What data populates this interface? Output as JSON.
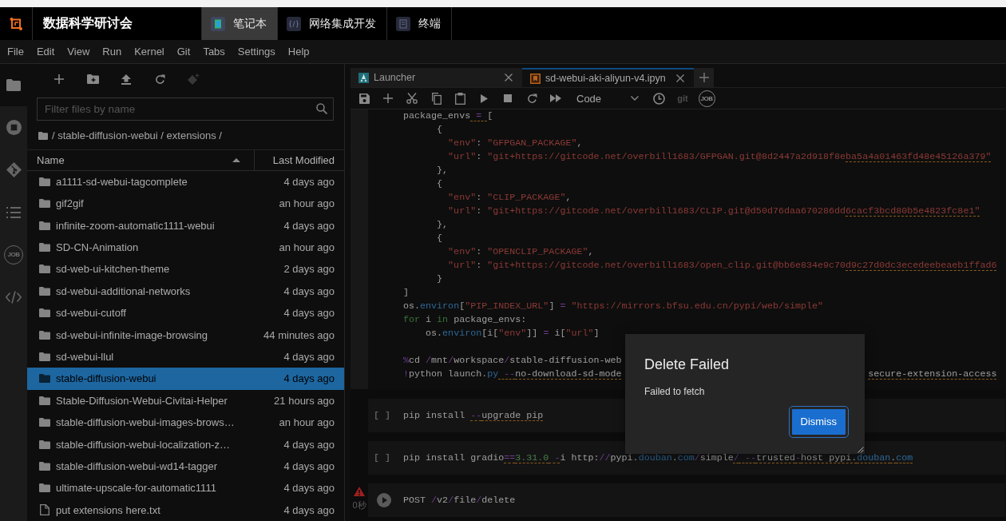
{
  "top_bar": {
    "title": "数据科学研讨会",
    "tabs": [
      {
        "kind": "notebook",
        "label": "笔记本",
        "selected": true
      },
      {
        "kind": "ide",
        "label": "网络集成开发",
        "selected": false
      },
      {
        "kind": "terminal",
        "label": "终端",
        "selected": false
      }
    ]
  },
  "menu": [
    "File",
    "Edit",
    "View",
    "Run",
    "Kernel",
    "Git",
    "Tabs",
    "Settings",
    "Help"
  ],
  "sidebar": {
    "items": [
      {
        "kind": "files",
        "selected": true
      },
      {
        "kind": "running",
        "selected": false
      },
      {
        "kind": "git",
        "selected": false
      },
      {
        "kind": "toc",
        "selected": false
      },
      {
        "kind": "jobs",
        "label": "JOB",
        "selected": false
      },
      {
        "kind": "snippets",
        "selected": false
      }
    ]
  },
  "file_browser": {
    "toolbar": [
      {
        "kind": "new-launcher",
        "disabled": false
      },
      {
        "kind": "new-folder",
        "disabled": false
      },
      {
        "kind": "upload",
        "disabled": false
      },
      {
        "kind": "refresh",
        "disabled": false
      },
      {
        "kind": "git-clone",
        "disabled": true
      }
    ],
    "filter": {
      "placeholder": "Filter files by name"
    },
    "breadcrumb": "/ stable-diffusion-webui / extensions /",
    "columns": [
      {
        "label": "Name",
        "sorted": true
      },
      {
        "label": "Last Modified",
        "sorted": false
      }
    ],
    "rows": [
      {
        "kind": "folder",
        "name": "a1111-sd-webui-tagcomplete",
        "modified": "4 days ago",
        "selected": false
      },
      {
        "kind": "folder",
        "name": "gif2gif",
        "modified": "an hour ago",
        "selected": false
      },
      {
        "kind": "folder",
        "name": "infinite-zoom-automatic1111-webui",
        "modified": "4 days ago",
        "selected": false
      },
      {
        "kind": "folder",
        "name": "SD-CN-Animation",
        "modified": "an hour ago",
        "selected": false
      },
      {
        "kind": "folder",
        "name": "sd-web-ui-kitchen-theme",
        "modified": "2 days ago",
        "selected": false
      },
      {
        "kind": "folder",
        "name": "sd-webui-additional-networks",
        "modified": "4 days ago",
        "selected": false
      },
      {
        "kind": "folder",
        "name": "sd-webui-cutoff",
        "modified": "4 days ago",
        "selected": false
      },
      {
        "kind": "folder",
        "name": "sd-webui-infinite-image-browsing",
        "modified": "44 minutes ago",
        "selected": false
      },
      {
        "kind": "folder",
        "name": "sd-webui-llul",
        "modified": "4 days ago",
        "selected": false
      },
      {
        "kind": "folder",
        "name": "stable-diffusion-webui",
        "modified": "4 days ago",
        "selected": true
      },
      {
        "kind": "folder",
        "name": "Stable-Diffusion-Webui-Civitai-Helper",
        "modified": "21 hours ago",
        "selected": false
      },
      {
        "kind": "folder",
        "name": "stable-diffusion-webui-images-brows…",
        "modified": "an hour ago",
        "selected": false
      },
      {
        "kind": "folder",
        "name": "stable-diffusion-webui-localization-z…",
        "modified": "4 days ago",
        "selected": false
      },
      {
        "kind": "folder",
        "name": "stable-diffusion-webui-wd14-tagger",
        "modified": "4 days ago",
        "selected": false
      },
      {
        "kind": "folder",
        "name": "ultimate-upscale-for-automatic1111",
        "modified": "4 days ago",
        "selected": false
      },
      {
        "kind": "file",
        "name": "put extensions here.txt",
        "modified": "4 days ago",
        "selected": false
      }
    ]
  },
  "notebook": {
    "tabs": [
      {
        "kind": "launcher",
        "label": "Launcher",
        "selected": false
      },
      {
        "kind": "notebook",
        "label": "sd-webui-aki-aliyun-v4.ipyn",
        "selected": true
      }
    ],
    "toolbar": {
      "cell_type": "Code",
      "git_label": "git",
      "job_label": "JOB"
    },
    "cells": [
      {
        "kind": "code",
        "selected": true,
        "error": false,
        "blocks": [
          [
            {
              "tokens": [
                {
                  "text": "package_envs",
                  "kind": "plain",
                  "underlined": false
                },
                {
                  "text": " = ",
                  "kind": "op",
                  "underlined": true
                },
                {
                  "text": "[",
                  "kind": "plain",
                  "underlined": false
                }
              ]
            },
            {
              "tokens": [
                {
                  "text": "      {",
                  "kind": "plain",
                  "underlined": false
                }
              ]
            },
            {
              "tokens": [
                {
                  "text": "        \"env\"",
                  "kind": "string",
                  "underlined": false
                },
                {
                  "text": ": ",
                  "kind": "plain",
                  "underlined": false
                },
                {
                  "text": "\"GFPGAN_PACKAGE\"",
                  "kind": "string",
                  "underlined": false
                },
                {
                  "text": ",",
                  "kind": "plain",
                  "underlined": false
                }
              ]
            },
            {
              "tokens": [
                {
                  "text": "        \"url\"",
                  "kind": "string",
                  "underlined": false
                },
                {
                  "text": ": ",
                  "kind": "plain",
                  "underlined": false
                },
                {
                  "text": "\"git+https://gitcode.net/overbill1683/GFPGAN.git@8d2447a2d918f8e",
                  "kind": "string",
                  "underlined": false
                },
                {
                  "text": "ba5a4a01463fd48e45126a379\"",
                  "kind": "string",
                  "underlined": true
                }
              ]
            },
            {
              "tokens": [
                {
                  "text": "      },",
                  "kind": "plain",
                  "underlined": false
                }
              ]
            },
            {
              "tokens": [
                {
                  "text": "      {",
                  "kind": "plain",
                  "underlined": false
                }
              ]
            },
            {
              "tokens": [
                {
                  "text": "        \"env\"",
                  "kind": "string",
                  "underlined": false
                },
                {
                  "text": ": ",
                  "kind": "plain",
                  "underlined": false
                },
                {
                  "text": "\"CLIP_PACKAGE\"",
                  "kind": "string",
                  "underlined": false
                },
                {
                  "text": ",",
                  "kind": "plain",
                  "underlined": false
                }
              ]
            },
            {
              "tokens": [
                {
                  "text": "        \"url\"",
                  "kind": "string",
                  "underlined": false
                },
                {
                  "text": ": ",
                  "kind": "plain",
                  "underlined": false
                },
                {
                  "text": "\"git+https://gitcode.net/overbill1683/CLIP.git@d50d76daa670286dd",
                  "kind": "string",
                  "underlined": false
                },
                {
                  "text": "6cacf3bcd80b5e4823fc8e1\"",
                  "kind": "string",
                  "underlined": true
                }
              ]
            },
            {
              "tokens": [
                {
                  "text": "      },",
                  "kind": "plain",
                  "underlined": false
                }
              ]
            },
            {
              "tokens": [
                {
                  "text": "      {",
                  "kind": "plain",
                  "underlined": false
                }
              ]
            },
            {
              "tokens": [
                {
                  "text": "        \"env\"",
                  "kind": "string",
                  "underlined": false
                },
                {
                  "text": ": ",
                  "kind": "plain",
                  "underlined": false
                },
                {
                  "text": "\"OPENCLIP_PACKAGE\"",
                  "kind": "string",
                  "underlined": false
                },
                {
                  "text": ",",
                  "kind": "plain",
                  "underlined": false
                }
              ]
            },
            {
              "tokens": [
                {
                  "text": "        \"url\"",
                  "kind": "string",
                  "underlined": false
                },
                {
                  "text": ": ",
                  "kind": "plain",
                  "underlined": false
                },
                {
                  "text": "\"git+https://gitcode.net/overbill1683/open_clip.git@bb6e834e9c70",
                  "kind": "string",
                  "underlined": false
                },
                {
                  "text": "d9c27d0dc3ecedeebeaeb1ffad6",
                  "kind": "string",
                  "underlined": true
                }
              ]
            },
            {
              "tokens": [
                {
                  "text": "      }",
                  "kind": "plain",
                  "underlined": false
                }
              ]
            },
            {
              "tokens": [
                {
                  "text": "]",
                  "kind": "plain",
                  "underlined": false
                }
              ]
            },
            {
              "tokens": [
                {
                  "text": "os.",
                  "kind": "plain",
                  "underlined": false
                },
                {
                  "text": "environ",
                  "kind": "builtin",
                  "underlined": false
                },
                {
                  "text": "[",
                  "kind": "plain",
                  "underlined": false
                },
                {
                  "text": "\"PIP_INDEX_URL\"",
                  "kind": "string",
                  "underlined": false
                },
                {
                  "text": "] ",
                  "kind": "plain",
                  "underlined": false
                },
                {
                  "text": "=",
                  "kind": "op",
                  "underlined": false
                },
                {
                  "text": " \"https://mirrors.bfsu.edu.cn/pypi/web/simple\"",
                  "kind": "string",
                  "underlined": false
                }
              ]
            },
            {
              "tokens": [
                {
                  "text": "for",
                  "kind": "keyword",
                  "underlined": false
                },
                {
                  "text": " i ",
                  "kind": "plain",
                  "underlined": false
                },
                {
                  "text": "in",
                  "kind": "keyword",
                  "underlined": false
                },
                {
                  "text": " package_envs:",
                  "kind": "plain",
                  "underlined": false
                }
              ]
            },
            {
              "tokens": [
                {
                  "text": "    os.",
                  "kind": "plain",
                  "underlined": false
                },
                {
                  "text": "environ",
                  "kind": "builtin",
                  "underlined": false
                },
                {
                  "text": "[i[",
                  "kind": "plain",
                  "underlined": false
                },
                {
                  "text": "\"env\"",
                  "kind": "string",
                  "underlined": false
                },
                {
                  "text": "]] ",
                  "kind": "plain",
                  "underlined": false
                },
                {
                  "text": "=",
                  "kind": "op",
                  "underlined": false
                },
                {
                  "text": " i[",
                  "kind": "plain",
                  "underlined": false
                },
                {
                  "text": "\"url\"",
                  "kind": "string",
                  "underlined": false
                },
                {
                  "text": "]",
                  "kind": "plain",
                  "underlined": false
                }
              ]
            }
          ],
          [
            {
              "tokens": [
                {
                  "text": "%",
                  "kind": "op",
                  "underlined": false
                },
                {
                  "text": "cd ",
                  "kind": "plain",
                  "underlined": false
                },
                {
                  "text": "/",
                  "kind": "op",
                  "underlined": false
                },
                {
                  "text": "mnt",
                  "kind": "plain",
                  "underlined": false
                },
                {
                  "text": "/",
                  "kind": "op",
                  "underlined": false
                },
                {
                  "text": "workspace",
                  "kind": "plain",
                  "underlined": false
                },
                {
                  "text": "/",
                  "kind": "op",
                  "underlined": false
                },
                {
                  "text": "stable-diffusion-web",
                  "kind": "plain",
                  "underlined": false
                }
              ]
            },
            {
              "tokens": [
                {
                  "text": "!",
                  "kind": "op",
                  "underlined": false
                },
                {
                  "text": "python launch.",
                  "kind": "plain",
                  "underlined": false
                },
                {
                  "text": "py",
                  "kind": "builtin",
                  "underlined": false
                },
                {
                  "text": " --",
                  "kind": "op",
                  "underlined": true
                },
                {
                  "text": "no-download-sd-mode",
                  "kind": "plain",
                  "underlined": true
                }
              ],
              "tail": [
                {
                  "text": "secure-extension-access",
                  "kind": "plain",
                  "underlined": true
                }
              ]
            }
          ]
        ]
      },
      {
        "kind": "code",
        "selected": false,
        "error": false,
        "prompt": "[ ]",
        "blocks": [
          [
            {
              "tokens": [
                {
                  "text": "pip install ",
                  "kind": "plain",
                  "underlined": false
                },
                {
                  "text": "--",
                  "kind": "op",
                  "underlined": true
                },
                {
                  "text": "upgrade pip",
                  "kind": "plain",
                  "underlined": true
                }
              ]
            }
          ]
        ]
      },
      {
        "kind": "code",
        "selected": false,
        "error": false,
        "prompt": "[ ]",
        "blocks": [
          [
            {
              "tokens": [
                {
                  "text": "pip install gradio",
                  "kind": "plain",
                  "underlined": false
                },
                {
                  "text": "==",
                  "kind": "op",
                  "underlined": true
                },
                {
                  "text": "3.31.0",
                  "kind": "number",
                  "underlined": true
                },
                {
                  "text": " -",
                  "kind": "op",
                  "underlined": true
                },
                {
                  "text": "i http:",
                  "kind": "plain",
                  "underlined": false
                },
                {
                  "text": "//",
                  "kind": "op",
                  "underlined": false
                },
                {
                  "text": "pypi.",
                  "kind": "plain",
                  "underlined": false
                },
                {
                  "text": "douban",
                  "kind": "builtin",
                  "underlined": false
                },
                {
                  "text": ".",
                  "kind": "plain",
                  "underlined": false
                },
                {
                  "text": "com",
                  "kind": "builtin",
                  "underlined": false
                },
                {
                  "text": "/",
                  "kind": "op",
                  "underlined": false
                },
                {
                  "text": "simple",
                  "kind": "plain",
                  "underlined": false
                },
                {
                  "text": "/",
                  "kind": "op",
                  "underlined": true
                },
                {
                  "text": " --",
                  "kind": "op",
                  "underlined": true
                },
                {
                  "text": "trusted",
                  "kind": "plain",
                  "underlined": true
                },
                {
                  "text": "-",
                  "kind": "op",
                  "underlined": true
                },
                {
                  "text": "host pypi.",
                  "kind": "plain",
                  "underlined": true
                },
                {
                  "text": "douban",
                  "kind": "builtin",
                  "underlined": true
                },
                {
                  "text": ".",
                  "kind": "plain",
                  "underlined": true
                },
                {
                  "text": "com",
                  "kind": "builtin",
                  "underlined": true
                }
              ]
            }
          ]
        ]
      },
      {
        "kind": "request",
        "selected": false,
        "error": true,
        "time": "0秒",
        "blocks": [
          [
            {
              "tokens": [
                {
                  "text": "POST ",
                  "kind": "plain",
                  "underlined": false
                },
                {
                  "text": "/",
                  "kind": "op",
                  "underlined": false
                },
                {
                  "text": "v2",
                  "kind": "plain",
                  "underlined": false
                },
                {
                  "text": "/",
                  "kind": "op",
                  "underlined": false
                },
                {
                  "text": "file",
                  "kind": "plain",
                  "underlined": false
                },
                {
                  "text": "/",
                  "kind": "op",
                  "underlined": false
                },
                {
                  "text": "delete",
                  "kind": "plain",
                  "underlined": false
                }
              ]
            }
          ]
        ]
      }
    ]
  },
  "dialog": {
    "title": "Delete Failed",
    "message": "Failed to fetch",
    "button": "Dismiss"
  }
}
